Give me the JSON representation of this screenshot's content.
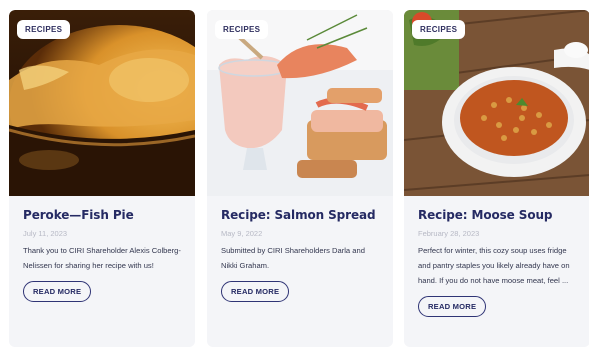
{
  "cards": [
    {
      "badge": "RECIPES",
      "title": "Peroke—Fish Pie",
      "date": "July 11, 2023",
      "excerpt": "Thank you to CIRI Shareholder Alexis Colberg-Nelissen for sharing her recipe with us!",
      "button": "READ MORE",
      "image_icon": "fish-pie-photo"
    },
    {
      "badge": "RECIPES",
      "title": "Recipe: Salmon Spread",
      "date": "May 9, 2022",
      "excerpt": "Submitted by CIRI Shareholders Darla and Nikki Graham.",
      "button": "READ MORE",
      "image_icon": "salmon-spread-photo"
    },
    {
      "badge": "RECIPES",
      "title": "Recipe: Moose Soup",
      "date": "February 28, 2023",
      "excerpt": "Perfect for winter, this cozy soup uses fridge and pantry staples you likely already have on hand. If you do not have moose meat, feel ...",
      "button": "READ MORE",
      "image_icon": "moose-soup-photo"
    }
  ],
  "colors": {
    "title": "#252a63",
    "card_bg": "#f4f5f8",
    "date": "#b7b9c5",
    "button_border": "#2f3475"
  }
}
